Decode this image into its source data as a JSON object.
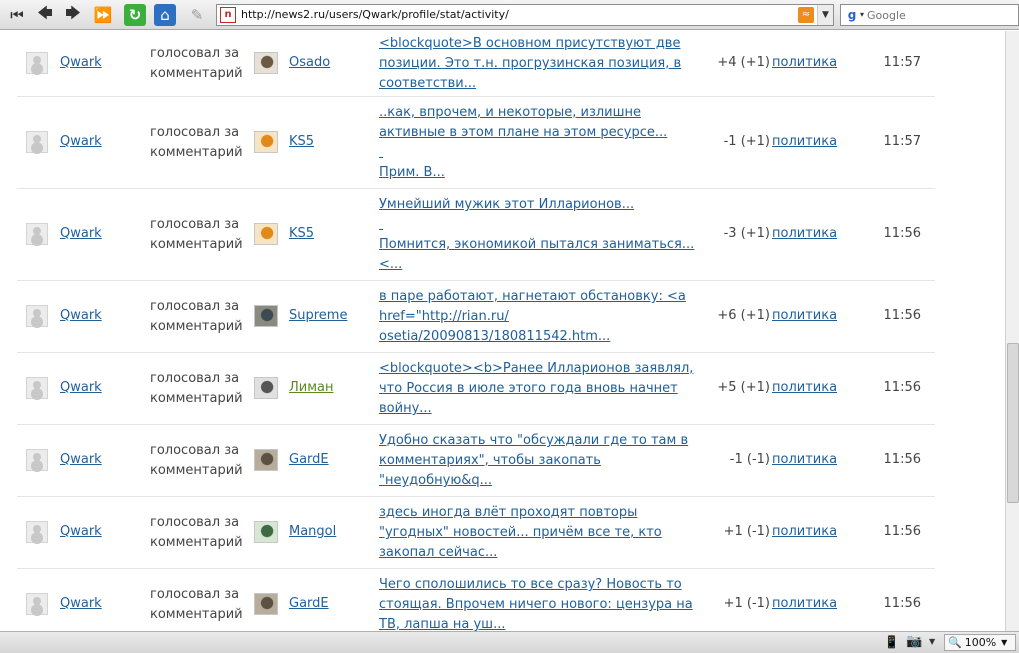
{
  "toolbar": {
    "url": "http://news2.ru/users/Qwark/profile/stat/activity/",
    "site_badge": "n",
    "search_placeholder": "Google",
    "google_icon": "g"
  },
  "rows": [
    {
      "user": "Qwark",
      "action": "голосовал за комментарий",
      "target": "Osado",
      "target_color": "#1f5f9a",
      "comment": [
        "<blockquote>В основном присутствуют две",
        "позиции. Это т.н. прогрузинская позиция, в",
        "соответстви..."
      ],
      "score": "+4 (+1)",
      "category": "политика",
      "time": "11:57"
    },
    {
      "user": "Qwark",
      "action": "голосовал за комментарий",
      "target": "KS5",
      "target_color": "#1f5f9a",
      "comment": [
        "..как, впрочем, и некоторые, излишне",
        "активные в этом плане на этом ресурсе...",
        "",
        "Прим. В..."
      ],
      "score": "-1 (+1)",
      "category": "политика",
      "time": "11:57"
    },
    {
      "user": "Qwark",
      "action": "голосовал за комментарий",
      "target": "KS5",
      "target_color": "#1f5f9a",
      "comment": [
        "Умнейший мужик этот Илларионов...",
        "",
        "Помнится, экономикой пытался заниматься...",
        "<..."
      ],
      "score": "-3 (+1)",
      "category": "политика",
      "time": "11:56"
    },
    {
      "user": "Qwark",
      "action": "голосовал за комментарий",
      "target": "Supreme",
      "target_color": "#1f5f9a",
      "comment": [
        "в паре работают, нагнетают обстановку: <a",
        "href=\"http://rian.ru/",
        "osetia/20090813/180811542.htm..."
      ],
      "score": "+6 (+1)",
      "category": "политика",
      "time": "11:56"
    },
    {
      "user": "Qwark",
      "action": "голосовал за комментарий",
      "target": "Лиман",
      "target_color": "#5a8a1e",
      "comment": [
        "<blockquote><b>Ранее Илларионов заявлял,",
        "что Россия в июле этого года вновь начнет",
        "войну..."
      ],
      "score": "+5 (+1)",
      "category": "политика",
      "time": "11:56"
    },
    {
      "user": "Qwark",
      "action": "голосовал за комментарий",
      "target": "GardE",
      "target_color": "#1f5f9a",
      "comment": [
        "Удобно сказать что \"обсуждали где то там в",
        "комментариях\", чтобы закопать",
        "\"неудобную&q..."
      ],
      "score": "-1 (-1)",
      "category": "политика",
      "time": "11:56"
    },
    {
      "user": "Qwark",
      "action": "голосовал за комментарий",
      "target": "Mangol",
      "target_color": "#1f5f9a",
      "comment": [
        "здесь иногда влёт проходят повторы",
        "\"угодных\" новостей... причём все те, кто",
        "закопал сейчас..."
      ],
      "score": "+1 (-1)",
      "category": "политика",
      "time": "11:56"
    },
    {
      "user": "Qwark",
      "action": "голосовал за комментарий",
      "target": "GardE",
      "target_color": "#1f5f9a",
      "comment": [
        "Чего сполошились то все сразу? Новость то",
        "стоящая. Впрочем ничего нового: цензура на",
        "ТВ, лапша на уш..."
      ],
      "score": "+1 (-1)",
      "category": "политика",
      "time": "11:56"
    }
  ],
  "status": {
    "zoom": "100%",
    "zoom_icon": "magnifier-icon"
  }
}
